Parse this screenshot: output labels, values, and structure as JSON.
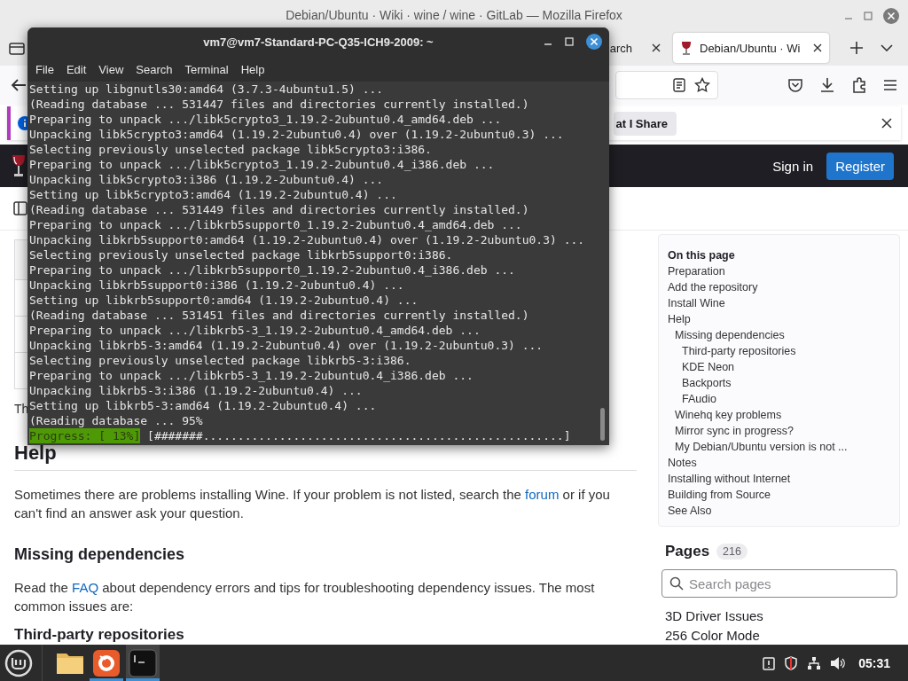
{
  "browser": {
    "title": "Debian/Ubuntu · Wiki · wine / wine · GitLab — Mozilla Firefox",
    "tabs": [
      {
        "label": "arch",
        "selected": false
      },
      {
        "label": "Debian/Ubuntu · Wi",
        "selected": true
      }
    ],
    "notification": {
      "button": "at I Share"
    },
    "header": {
      "sign_in": "Sign in",
      "register": "Register"
    },
    "article": {
      "cut_text": "Th",
      "blocks": [
        {
          "kind": "h2",
          "parts": [
            {
              "text": "Help"
            }
          ]
        },
        {
          "kind": "p",
          "parts": [
            {
              "text": "Sometimes there are problems installing Wine. If your problem is not listed, search the "
            },
            {
              "text": "forum",
              "link": true
            },
            {
              "text": " or if you can't find an answer ask your question."
            }
          ]
        },
        {
          "kind": "h3",
          "parts": [
            {
              "text": "Missing dependencies"
            }
          ]
        },
        {
          "kind": "p",
          "parts": [
            {
              "text": "Read the "
            },
            {
              "text": "FAQ",
              "link": true
            },
            {
              "text": " about dependency errors and tips for troubleshooting dependency issues. The most common issues are:"
            }
          ]
        },
        {
          "kind": "h4",
          "parts": [
            {
              "text": "Third-party repositories"
            }
          ]
        }
      ]
    },
    "toc": {
      "title": "On this page",
      "items": [
        {
          "label": "Preparation"
        },
        {
          "label": "Add the repository"
        },
        {
          "label": "Install Wine"
        },
        {
          "label": "Help",
          "children": [
            {
              "label": "Missing dependencies",
              "children": [
                {
                  "label": "Third-party repositories"
                },
                {
                  "label": "KDE Neon"
                },
                {
                  "label": "Backports"
                },
                {
                  "label": "FAudio"
                }
              ]
            },
            {
              "label": "Winehq key problems"
            },
            {
              "label": "Mirror sync in progress?"
            },
            {
              "label": "My Debian/Ubuntu version is not ..."
            }
          ]
        },
        {
          "label": "Notes"
        },
        {
          "label": "Installing without Internet"
        },
        {
          "label": "Building from Source"
        },
        {
          "label": "See Also"
        }
      ]
    },
    "pages": {
      "title": "Pages",
      "count": "216",
      "search_placeholder": "Search pages",
      "items": [
        "3D Driver Issues",
        "256 Color Mode"
      ]
    }
  },
  "terminal": {
    "title": "vm7@vm7-Standard-PC-Q35-ICH9-2009: ~",
    "menu": [
      "File",
      "Edit",
      "View",
      "Search",
      "Terminal",
      "Help"
    ],
    "lines": [
      "Setting up libgnutls30:amd64 (3.7.3-4ubuntu1.5) ...",
      "(Reading database ... 531447 files and directories currently installed.)",
      "Preparing to unpack .../libk5crypto3_1.19.2-2ubuntu0.4_amd64.deb ...",
      "Unpacking libk5crypto3:amd64 (1.19.2-2ubuntu0.4) over (1.19.2-2ubuntu0.3) ...",
      "Selecting previously unselected package libk5crypto3:i386.",
      "Preparing to unpack .../libk5crypto3_1.19.2-2ubuntu0.4_i386.deb ...",
      "Unpacking libk5crypto3:i386 (1.19.2-2ubuntu0.4) ...",
      "Setting up libk5crypto3:amd64 (1.19.2-2ubuntu0.4) ...",
      "(Reading database ... 531449 files and directories currently installed.)",
      "Preparing to unpack .../libkrb5support0_1.19.2-2ubuntu0.4_amd64.deb ...",
      "Unpacking libkrb5support0:amd64 (1.19.2-2ubuntu0.4) over (1.19.2-2ubuntu0.3) ...",
      "Selecting previously unselected package libkrb5support0:i386.",
      "Preparing to unpack .../libkrb5support0_1.19.2-2ubuntu0.4_i386.deb ...",
      "Unpacking libkrb5support0:i386 (1.19.2-2ubuntu0.4) ...",
      "Setting up libkrb5support0:amd64 (1.19.2-2ubuntu0.4) ...",
      "(Reading database ... 531451 files and directories currently installed.)",
      "Preparing to unpack .../libkrb5-3_1.19.2-2ubuntu0.4_amd64.deb ...",
      "Unpacking libkrb5-3:amd64 (1.19.2-2ubuntu0.4) over (1.19.2-2ubuntu0.3) ...",
      "Selecting previously unselected package libkrb5-3:i386.",
      "Preparing to unpack .../libkrb5-3_1.19.2-2ubuntu0.4_i386.deb ...",
      "Unpacking libkrb5-3:i386 (1.19.2-2ubuntu0.4) ...",
      "Setting up libkrb5-3:amd64 (1.19.2-2ubuntu0.4) ...",
      "(Reading database ... 95%"
    ],
    "progress": {
      "label": "Progress: [ 13%]",
      "bar": "[#######....................................................]"
    }
  },
  "taskbar": {
    "apps": [
      {
        "kind": "folder",
        "running": false,
        "selected": false
      },
      {
        "kind": "firefox",
        "running": true,
        "selected": false
      },
      {
        "kind": "terminal",
        "running": true,
        "selected": true
      }
    ],
    "clock": "05:31"
  }
}
